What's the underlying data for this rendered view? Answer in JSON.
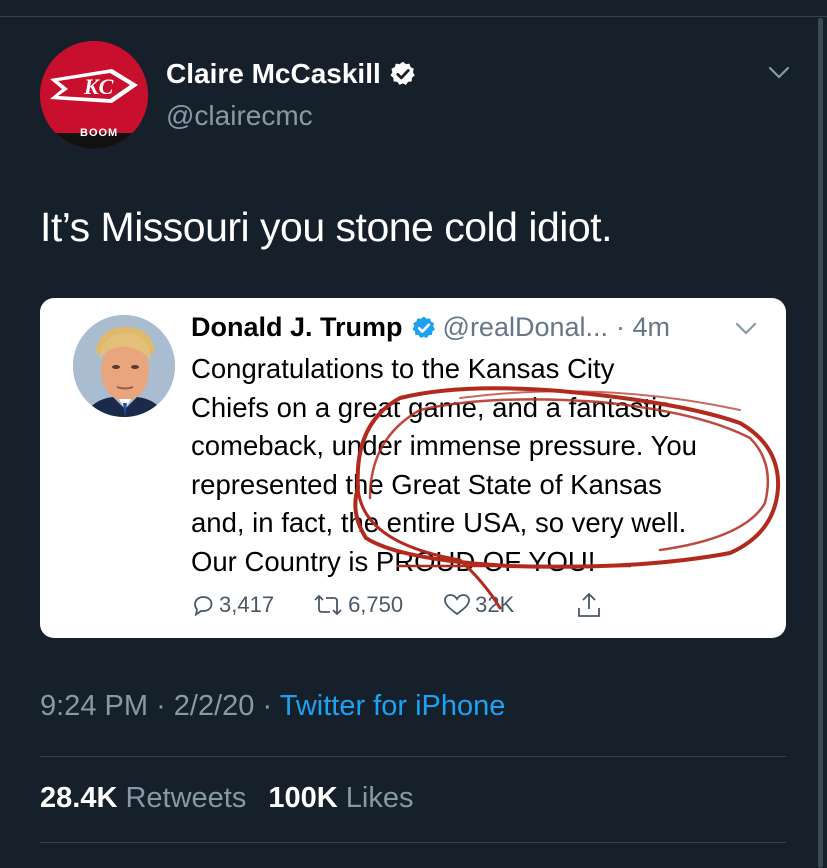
{
  "tweet": {
    "author_name": "Claire McCaskill",
    "author_handle": "@clairecmc",
    "avatar_text": "BOOM",
    "text": "It’s Missouri you stone cold idiot.",
    "time": "9:24 PM",
    "date": "2/2/20",
    "separator": "·",
    "source": "Twitter for iPhone",
    "retweets_count": "28.4K",
    "retweets_label": "Retweets",
    "likes_count": "100K",
    "likes_label": "Likes"
  },
  "quoted": {
    "author_name": "Donald J. Trump",
    "author_handle": "@realDonal...",
    "time": "· 4m",
    "lines": [
      "Congratulations to the Kansas City",
      "Chiefs on a great game, and a fantastic",
      "comeback, under immense pressure. You",
      "represented the Great State of Kansas",
      "and, in fact, the entire USA, so very well.",
      "Our Country is PROUD OF YOU!"
    ],
    "replies": "3,417",
    "retweets": "6,750",
    "likes": "32K"
  },
  "colors": {
    "background": "#15202b",
    "accent": "#1da1f2",
    "muted": "#8899a6",
    "chiefs_red": "#c8102e",
    "annotation_red": "#b22a1e"
  },
  "icons": [
    "verified-badge-icon",
    "chevron-down-icon",
    "reply-icon",
    "retweet-icon",
    "like-icon",
    "share-icon"
  ]
}
